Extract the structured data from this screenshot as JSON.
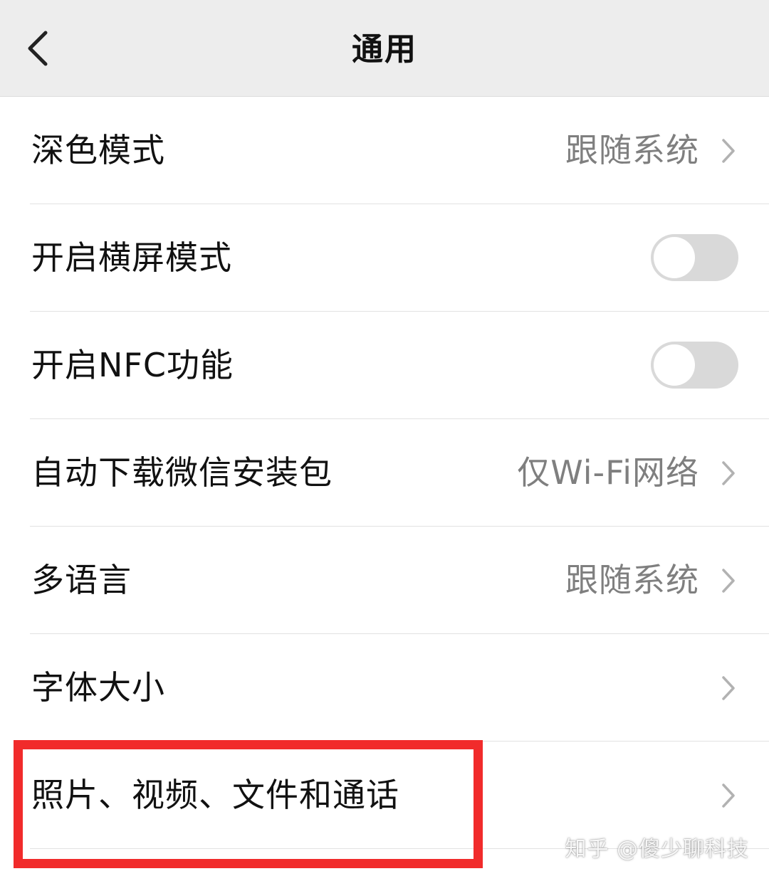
{
  "header": {
    "title": "通用",
    "back_icon": "chevron-left-icon"
  },
  "settings": {
    "dark_mode": {
      "label": "深色模式",
      "value": "跟随系统"
    },
    "landscape_mode": {
      "label": "开启横屏模式",
      "enabled": false
    },
    "nfc": {
      "label": "开启NFC功能",
      "enabled": false
    },
    "auto_download": {
      "label": "自动下载微信安装包",
      "value": "仅Wi-Fi网络"
    },
    "language": {
      "label": "多语言",
      "value": "跟随系统"
    },
    "font_size": {
      "label": "字体大小"
    },
    "media": {
      "label": "照片、视频、文件和通话"
    }
  },
  "highlight": {
    "color": "#f12b2b"
  },
  "watermark": {
    "text": "知乎 @傻少聊科技"
  },
  "colors": {
    "header_bg": "#ededed",
    "label": "#111111",
    "value": "#7f7f7f",
    "toggle_off": "#d9d9d9"
  }
}
